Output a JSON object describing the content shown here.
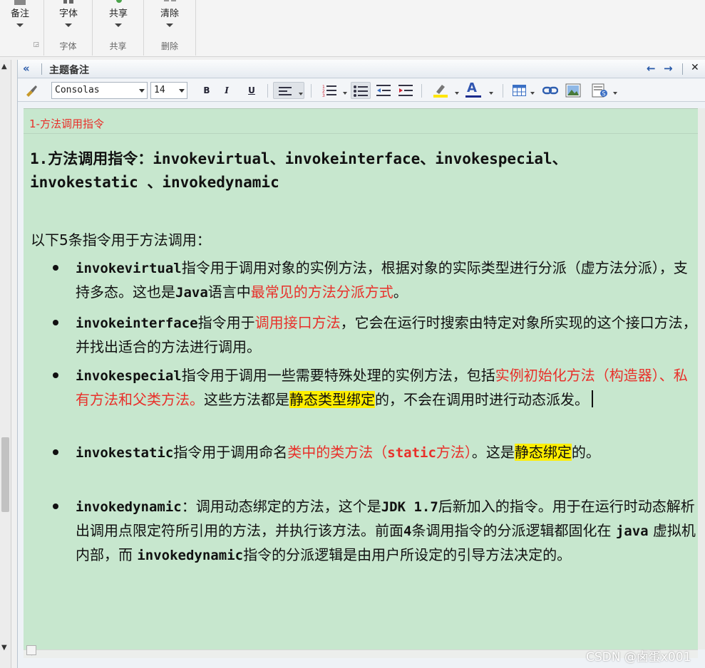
{
  "ribbon": {
    "groups": [
      {
        "name": "",
        "buttons": [
          {
            "label": "备注"
          }
        ]
      },
      {
        "name": "字体",
        "buttons": [
          {
            "label": "字体"
          }
        ]
      },
      {
        "name": "共享",
        "buttons": [
          {
            "label": "共享"
          }
        ]
      },
      {
        "name": "删除",
        "buttons": [
          {
            "label": "清除"
          }
        ]
      }
    ]
  },
  "panel": {
    "title": "主题备注",
    "toolbar": {
      "font_family": "Consolas",
      "font_size": "14",
      "bold": "B",
      "italic": "I",
      "underline": "U",
      "font_color_glyph": "A",
      "icons": [
        "brush-icon",
        "align-left-icon",
        "numbered-list-icon",
        "bullet-list-icon",
        "outdent-icon",
        "indent-icon",
        "highlighter-icon",
        "font-color-icon",
        "table-icon",
        "link-icon",
        "image-icon",
        "insert-symbol-icon"
      ]
    }
  },
  "note": {
    "title": "1-方法调用指令",
    "heading_line1": "1.方法调用指令：invokevirtual、invokeinterface、invokespecial、",
    "heading_line2": "invokestatic 、invokedynamic",
    "intro": "以下5条指令用于方法调用：",
    "items": [
      {
        "code": "invokevirtual",
        "t1": "指令用于调用对象的实例方法，根据对象的实际类型进行分派（虚方法分派），支持多态。这也是",
        "code2": "Java",
        "t2": "语言中",
        "red": "最常见的方法分派方式",
        "t3": "。"
      },
      {
        "code": "invokeinterface",
        "t1": "指令用于",
        "red": "调用接口方法",
        "t2": "，它会在运行时搜索由特定对象所实现的这个接口方法，并找出适合的方法进行调用。"
      },
      {
        "code": "invokespecial",
        "t1": "指令用于调用一些需要特殊处理的实例方法，包括",
        "red": "实例初始化方法（构造器）、私有方法和父类方法。",
        "t2": "这些方法都是",
        "hl": "静态类型绑定",
        "t3": "的，不会在调用时进行动态派发。"
      },
      {
        "code": "invokestatic",
        "t1": "指令用于调用命名",
        "red": "类中的类方法（",
        "redcode": "static",
        "red2": "方法）",
        "t2": "。这是",
        "hl": "静态绑定",
        "t3": "的。"
      },
      {
        "code": "invokedynamic",
        "t1": "：调用动态绑定的方法，这个是",
        "code2": "JDK 1.7",
        "t2": "后新加入的指令。用于在运行时动态解析出调用点限定符所引用的方法，并执行该方法。前面",
        "code3": "4",
        "t3": "条调用指令的分派逻辑都固化在 ",
        "code4": "java",
        "t4": " 虚拟机内部，而 ",
        "code5": "invokedynamic",
        "t5": "指令的分派逻辑是由用户所设定的引导方法决定的。"
      }
    ]
  },
  "watermark": "CSDN @卤蛋x001",
  "colors": {
    "editor_bg": "#c7e7ce",
    "red": "#e8302a",
    "highlight": "#ffee00",
    "accent": "#2859a8"
  }
}
